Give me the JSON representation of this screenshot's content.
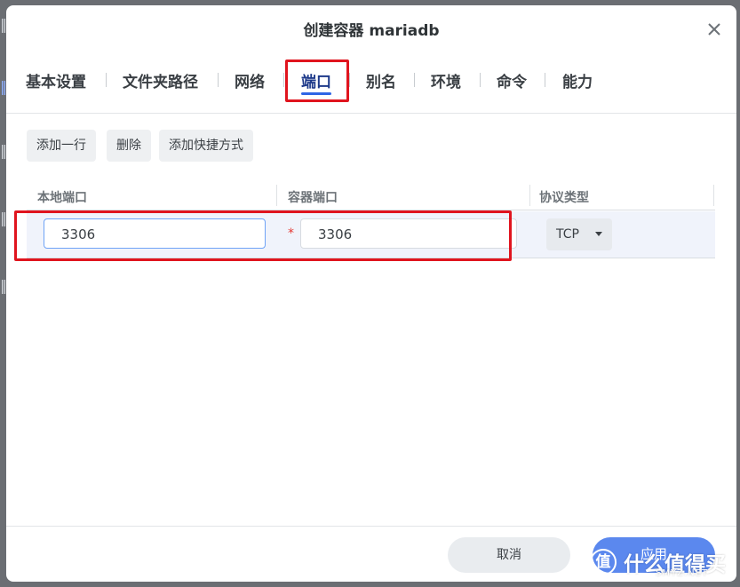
{
  "dialog": {
    "title": "创建容器 mariadb",
    "close_icon": "close-icon"
  },
  "tabs": [
    {
      "label": "基本设置",
      "active": false
    },
    {
      "label": "文件夹路径",
      "active": false
    },
    {
      "label": "网络",
      "active": false
    },
    {
      "label": "端口",
      "active": true
    },
    {
      "label": "别名",
      "active": false
    },
    {
      "label": "环境",
      "active": false
    },
    {
      "label": "命令",
      "active": false
    },
    {
      "label": "能力",
      "active": false
    }
  ],
  "toolbar": {
    "add_row": "添加一行",
    "delete": "删除",
    "add_shortcut": "添加快捷方式"
  },
  "table": {
    "headers": [
      "本地端口",
      "容器端口",
      "协议类型"
    ],
    "rows": [
      {
        "local_port": "3306",
        "required_mark": "*",
        "container_port": "3306",
        "protocol": "TCP"
      }
    ]
  },
  "footer": {
    "cancel": "取消",
    "apply": "应用"
  },
  "watermark": {
    "logo": "值",
    "text": "什么值得买",
    "sub": "SMYZ.NET"
  },
  "colors": {
    "accent": "#2f66e5",
    "apply_button": "#5b88ee",
    "highlight_box": "#e0141e",
    "required": "#e53935"
  }
}
